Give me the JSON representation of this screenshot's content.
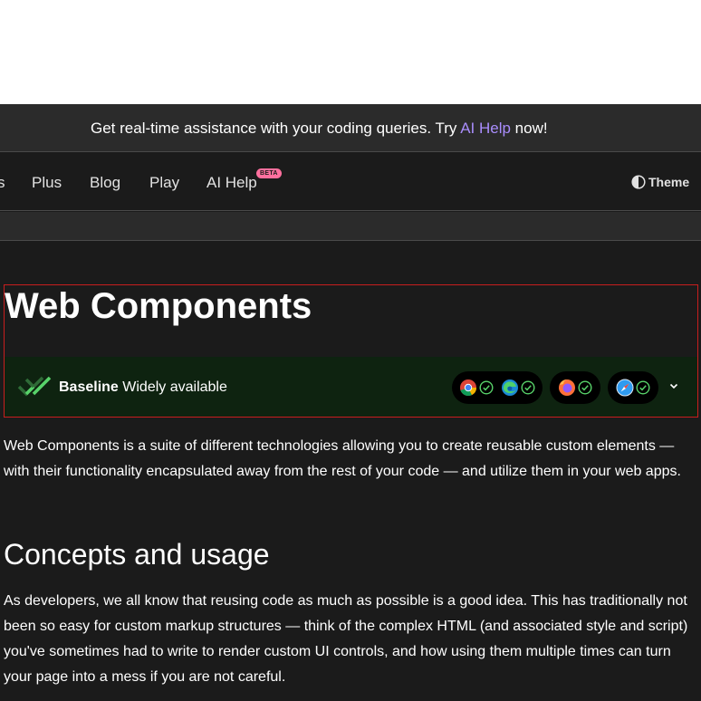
{
  "banner": {
    "text_before": "Get real-time assistance with your coding queries. Try ",
    "link": "AI Help",
    "text_after": " now!"
  },
  "nav": {
    "partial_item": "s",
    "items": [
      "Plus",
      "Blog",
      "Play",
      "AI Help"
    ],
    "badge": "BETA",
    "theme_label": "Theme"
  },
  "article": {
    "title": "Web Components",
    "baseline": {
      "strong": "Baseline",
      "label": "Widely available",
      "browsers": [
        "chrome-icon",
        "edge-icon",
        "firefox-icon",
        "safari-icon"
      ],
      "status_color": "#58d36a"
    },
    "intro": "Web Components is a suite of different technologies allowing you to create reusable custom elements — with their functionality encapsulated away from the rest of your code — and utilize them in your web apps.",
    "heading": "Concepts and usage",
    "para": "As developers, we all know that reusing code as much as possible is a good idea. This has traditionally not been so easy for custom markup structures — think of the complex HTML (and associated style and script) you've sometimes had to write to render custom UI controls, and how using them multiple times can turn your page into a mess if you are not careful."
  },
  "colors": {
    "background": "#1b1b1b",
    "accent_link": "#a98dfc",
    "badge": "#ff709e",
    "baseline_bg": "#0e2310"
  }
}
